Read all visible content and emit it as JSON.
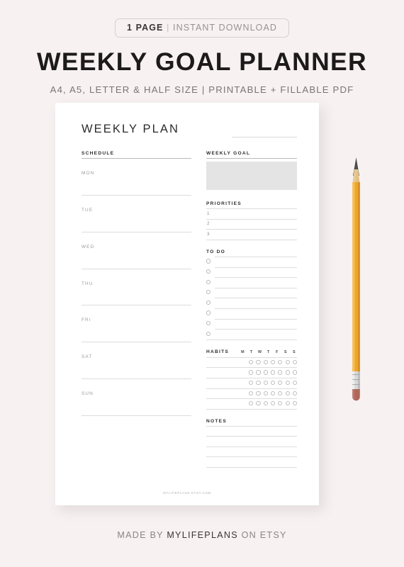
{
  "header": {
    "badge_strong": "1 PAGE",
    "badge_separator": "|",
    "badge_rest": "INSTANT DOWNLOAD",
    "title": "WEEKLY GOAL PLANNER",
    "subtitle": "A4, A5, LETTER & HALF SIZE | PRINTABLE + FILLABLE PDF"
  },
  "planner": {
    "title": "WEEKLY PLAN",
    "schedule": {
      "heading": "SCHEDULE",
      "days": [
        "MON",
        "TUE",
        "WED",
        "THU",
        "FRI",
        "SAT",
        "SUN"
      ]
    },
    "weekly_goal": {
      "heading": "WEEKLY GOAL"
    },
    "priorities": {
      "heading": "PRIORITIES",
      "items": [
        "1",
        "2",
        "3"
      ]
    },
    "todo": {
      "heading": "TO DO",
      "row_count": 8
    },
    "habits": {
      "heading": "HABITS",
      "day_initials": [
        "M",
        "T",
        "W",
        "T",
        "F",
        "S",
        "S"
      ],
      "row_count": 5
    },
    "notes": {
      "heading": "NOTES",
      "row_count": 4
    },
    "watermark": "MYLIFEPLANS.ETSY.COM"
  },
  "pencil": {
    "body_color": "#eda72c",
    "tip_color": "#4a4a4a",
    "wood_color": "#e8c98f",
    "ferrule_color": "#d8d8d8",
    "eraser_color": "#b0675a"
  },
  "footer": {
    "prefix": "MADE BY",
    "brand": "MYLIFEPLANS",
    "suffix": "ON ETSY"
  },
  "colors": {
    "background": "#f7f1f2",
    "page": "#ffffff",
    "goal_fill": "#e4e4e4"
  }
}
